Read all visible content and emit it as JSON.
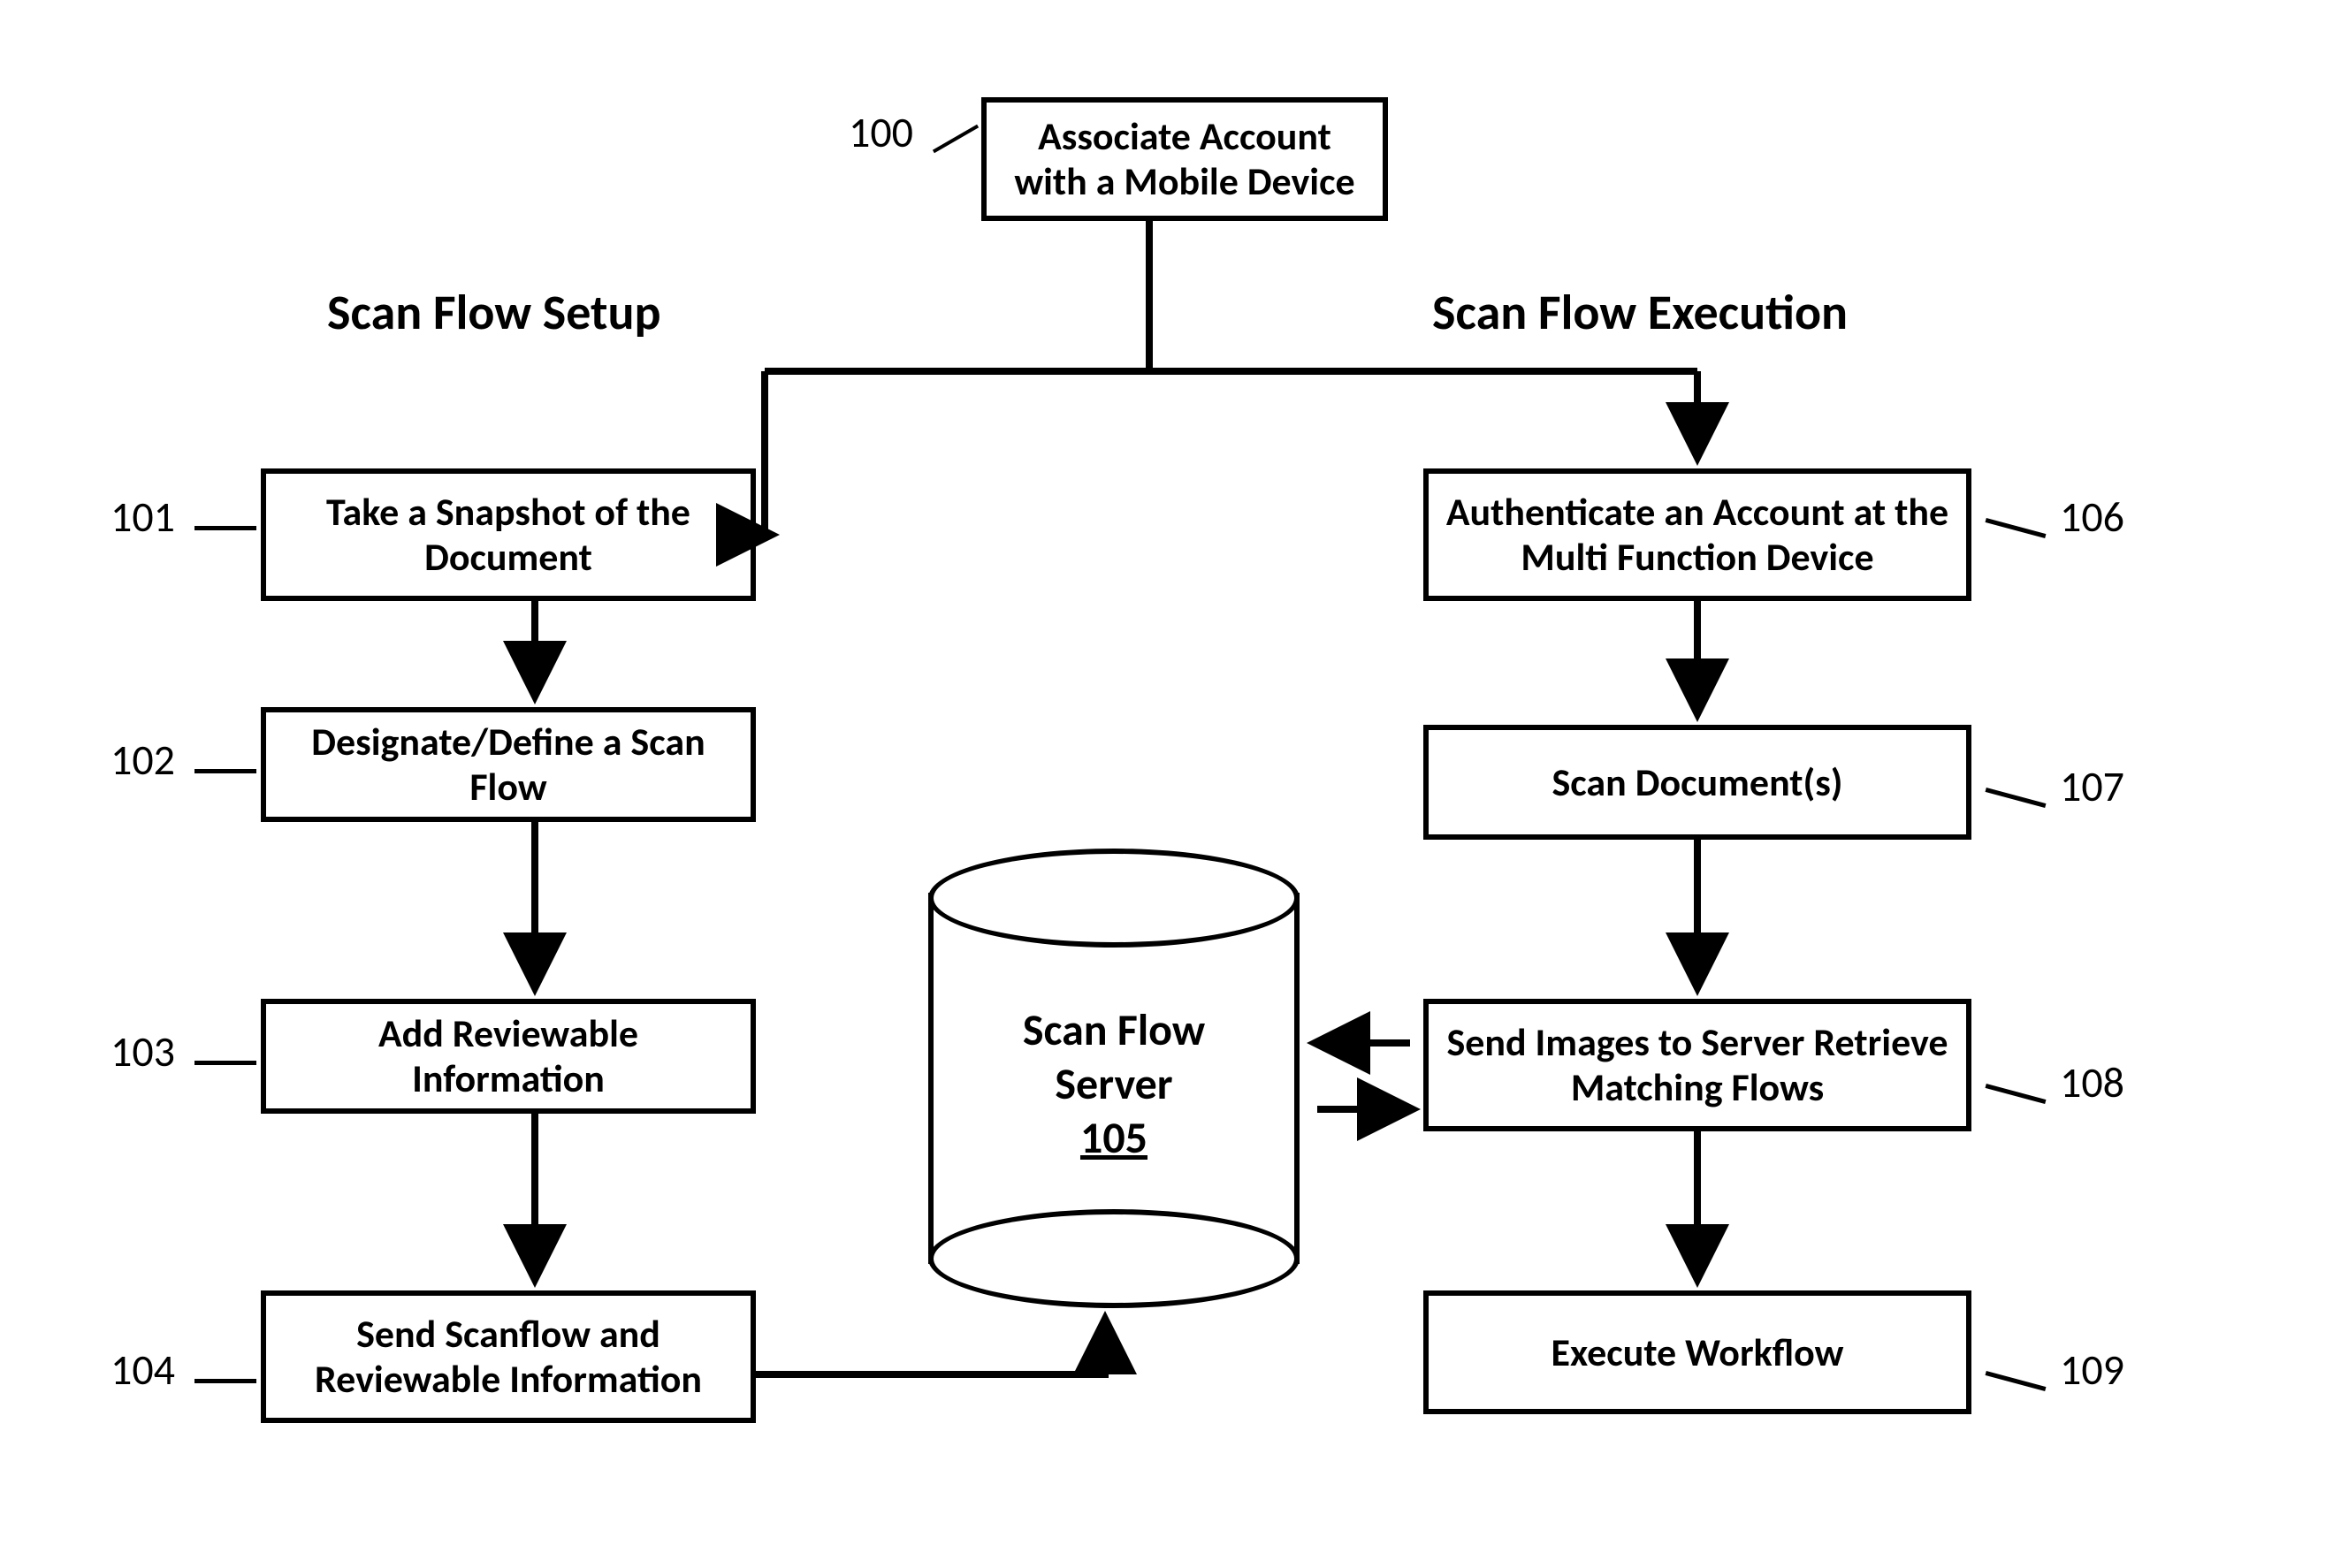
{
  "titles": {
    "left": "Scan Flow Setup",
    "right": "Scan Flow Execution"
  },
  "refs": {
    "r100": "100",
    "r101": "101",
    "r102": "102",
    "r103": "103",
    "r104": "104",
    "r106": "106",
    "r107": "107",
    "r108": "108",
    "r109": "109"
  },
  "nodes": {
    "n100": "Associate Account with a Mobile Device",
    "n101": "Take a Snapshot of the Document",
    "n102": "Designate/Define a Scan Flow",
    "n103": "Add Reviewable Information",
    "n104": "Send Scanflow and Reviewable Information",
    "n106": "Authenticate an Account at the Multi Function Device",
    "n107": "Scan Document(s)",
    "n108": "Send Images to Server Retrieve Matching Flows",
    "n109": "Execute Workflow"
  },
  "cylinder": {
    "line1": "Scan Flow",
    "line2": "Server",
    "num": "105"
  }
}
